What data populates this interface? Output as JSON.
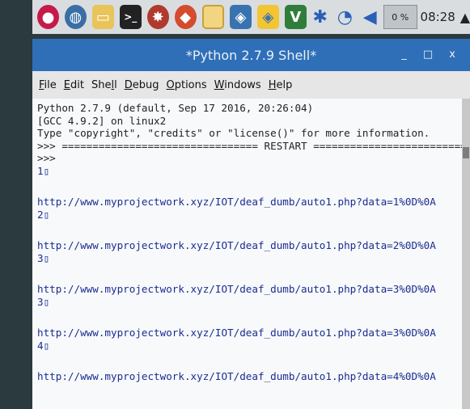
{
  "panel": {
    "icons": [
      "raspberry-icon",
      "globe-icon",
      "folder-icon",
      "terminal-icon",
      "burst-icon",
      "wolf-icon",
      "notes-icon",
      "python-icon",
      "python-icon",
      "vnc-icon",
      "bluetooth-icon",
      "wifi-icon",
      "volume-icon"
    ],
    "terminal_glyph": ">_",
    "cpu": "0 %",
    "clock": "08:28",
    "eject": "▲"
  },
  "window": {
    "title": "*Python 2.7.9 Shell*",
    "controls": "_ □ x"
  },
  "menu": [
    {
      "pre": "",
      "u": "F",
      "post": "ile"
    },
    {
      "pre": "",
      "u": "E",
      "post": "dit"
    },
    {
      "pre": "She",
      "u": "l",
      "post": "l"
    },
    {
      "pre": "",
      "u": "D",
      "post": "ebug"
    },
    {
      "pre": "",
      "u": "O",
      "post": "ptions"
    },
    {
      "pre": "",
      "u": "W",
      "post": "indows"
    },
    {
      "pre": "",
      "u": "H",
      "post": "elp"
    }
  ],
  "shell": {
    "banner1": "Python 2.7.9 (default, Sep 17 2016, 20:26:04)",
    "banner2": "[GCC 4.9.2] on linux2",
    "banner3": "Type \"copyright\", \"credits\" or \"license()\" for more information.",
    "restart": ">>> ================================ RESTART ================================",
    "prompt": ">>>",
    "outputs": [
      {
        "value": "1▯",
        "url": "http://www.myprojectwork.xyz/IOT/deaf_dumb/auto1.php?data=1%0D%0A"
      },
      {
        "value": "2▯",
        "url": "http://www.myprojectwork.xyz/IOT/deaf_dumb/auto1.php?data=2%0D%0A"
      },
      {
        "value": "3▯",
        "url": "http://www.myprojectwork.xyz/IOT/deaf_dumb/auto1.php?data=3%0D%0A"
      },
      {
        "value": "3▯",
        "url": "http://www.myprojectwork.xyz/IOT/deaf_dumb/auto1.php?data=3%0D%0A"
      },
      {
        "value": "4▯",
        "url": "http://www.myprojectwork.xyz/IOT/deaf_dumb/auto1.php?data=4%0D%0A"
      }
    ]
  }
}
